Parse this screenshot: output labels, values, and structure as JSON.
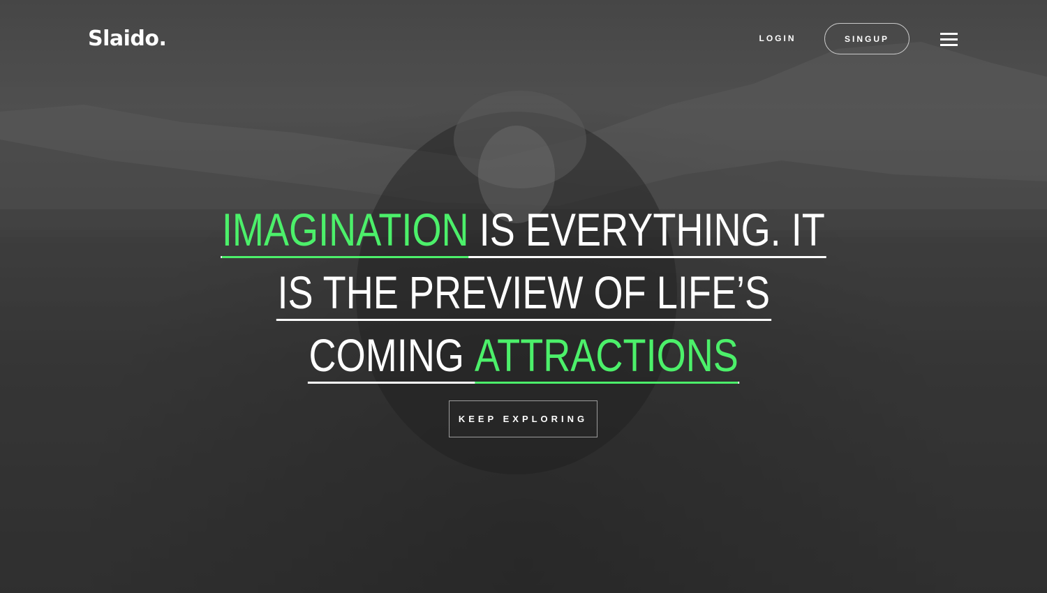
{
  "header": {
    "logo": "Slaido.",
    "login_label": "LOGIN",
    "signup_label": "SINGUP",
    "menu_icon": "hamburger-menu-icon"
  },
  "hero": {
    "line1_accent": "IMAGINATION",
    "line1_rest": " IS EVERYTHING. IT",
    "line2": "IS THE PREVIEW OF LIFE’S",
    "line3_rest": "COMING ",
    "line3_accent": "ATTRACTIONS",
    "cta_label": "KEEP EXPLORING"
  },
  "colors": {
    "accent": "#4cf06a",
    "text": "#ffffff",
    "overlay": "#000000"
  }
}
